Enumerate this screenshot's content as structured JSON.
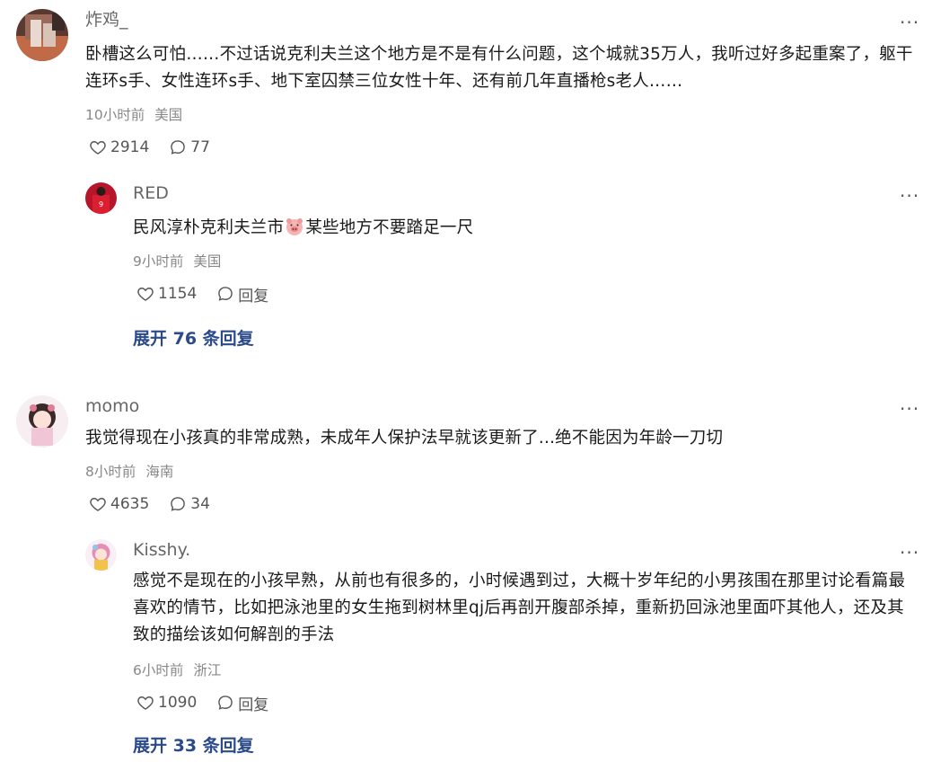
{
  "thread1": {
    "comment": {
      "username": "炸鸡_",
      "text": "卧槽这么可怕……不过话说克利夫兰这个地方是不是有什么问题，这个城就35万人，我听过好多起重案了，躯干连环s手、女性连环s手、地下室囚禁三位女性十年、还有前几年直播枪s老人……",
      "time": "10小时前",
      "location": "美国",
      "likes": "2914",
      "replies": "77"
    },
    "reply": {
      "username": "RED",
      "text_before": "民风淳朴克利夫兰市",
      "text_after": "某些地方不要踏足一尺",
      "time": "9小时前",
      "location": "美国",
      "likes": "1154",
      "reply_label": "回复"
    },
    "expand_label": "展开 76 条回复"
  },
  "thread2": {
    "comment": {
      "username": "momo",
      "text": "我觉得现在小孩真的非常成熟，未成年人保护法早就该更新了...绝不能因为年龄一刀切",
      "time": "8小时前",
      "location": "海南",
      "likes": "4635",
      "replies": "34"
    },
    "reply": {
      "username": "Kisshy.",
      "text": "感觉不是现在的小孩早熟，从前也有很多的，小时候遇到过，大概十岁年纪的小男孩围在那里讨论看篇最喜欢的情节，比如把泳池里的女生拖到树林里qj后再剖开腹部杀掉，重新扔回泳池里面吓其他人，还及其致的描绘该如何解剖的手法",
      "time": "6小时前",
      "location": "浙江",
      "likes": "1090",
      "reply_label": "回复"
    },
    "expand_label": "展开 33 条回复"
  },
  "icons": {
    "more": "more-dots-icon",
    "like": "heart-outline-icon",
    "comment": "speech-bubble-icon",
    "emoji": "pig-face-emoji"
  },
  "colors": {
    "text": "#1a1a1a",
    "muted": "#888888",
    "username": "#666666",
    "link": "#2a4a8a"
  }
}
